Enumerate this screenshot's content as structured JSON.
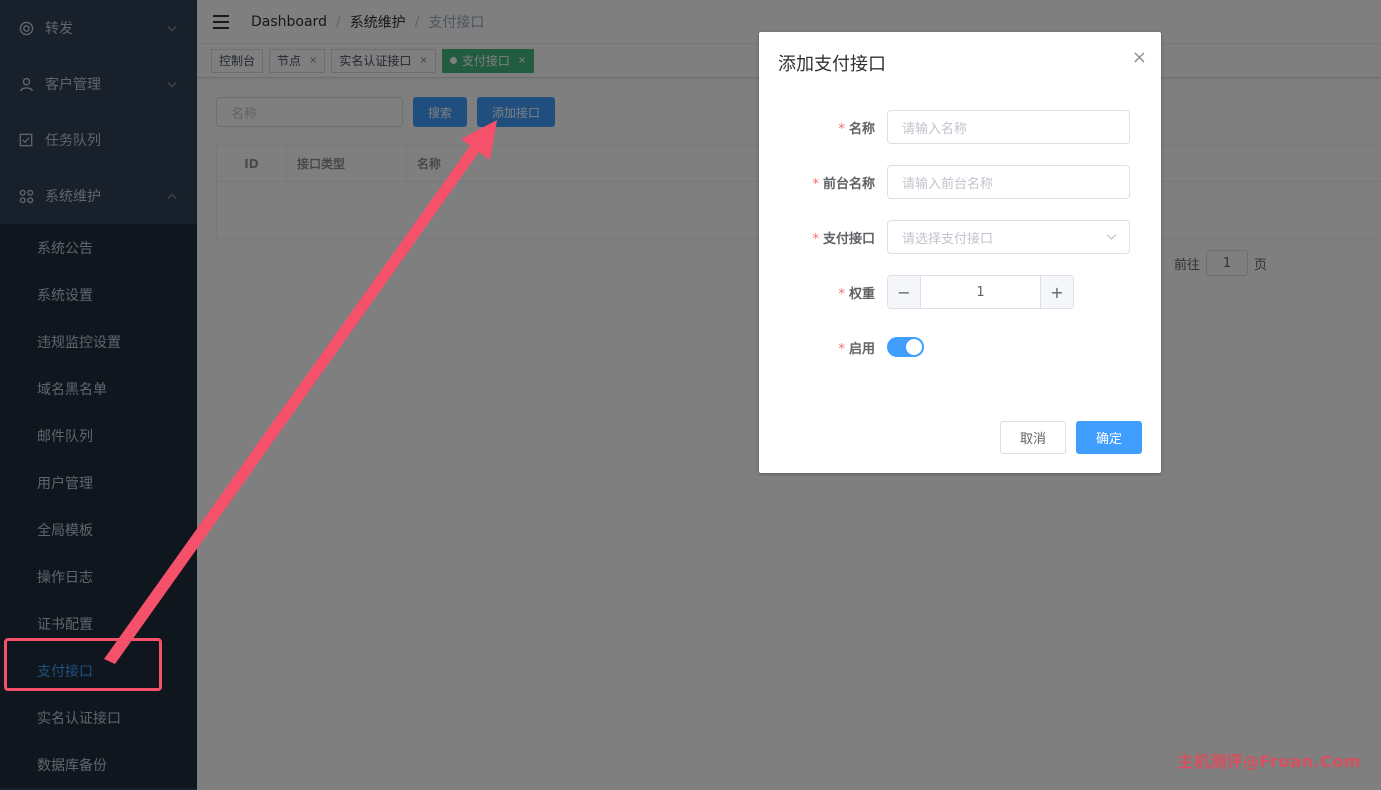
{
  "sidebar": {
    "top_items": [
      {
        "label": "转发",
        "icon": "target-icon"
      },
      {
        "label": "客户管理",
        "icon": "user-icon"
      },
      {
        "label": "任务队列",
        "icon": "checkbox-icon"
      },
      {
        "label": "系统维护",
        "icon": "command-icon"
      }
    ],
    "sub_items": [
      {
        "label": "系统公告"
      },
      {
        "label": "系统设置"
      },
      {
        "label": "违规监控设置"
      },
      {
        "label": "域名黑名单"
      },
      {
        "label": "邮件队列"
      },
      {
        "label": "用户管理"
      },
      {
        "label": "全局模板"
      },
      {
        "label": "操作日志"
      },
      {
        "label": "证书配置"
      },
      {
        "label": "支付接口"
      },
      {
        "label": "实名认证接口"
      },
      {
        "label": "数据库备份"
      }
    ],
    "active_item": "支付接口"
  },
  "breadcrumb": {
    "items": [
      "Dashboard",
      "系统维护",
      "支付接口"
    ],
    "separator": "/"
  },
  "tags": [
    {
      "label": "控制台"
    },
    {
      "label": "节点",
      "close": "×"
    },
    {
      "label": "实名认证接口",
      "close": "×"
    },
    {
      "label": "支付接口",
      "close": "×",
      "active": true
    }
  ],
  "filter": {
    "name_placeholder": "名称",
    "search_label": "搜索",
    "add_label": "添加接口"
  },
  "table": {
    "columns": [
      "ID",
      "接口类型",
      "名称"
    ]
  },
  "pager": {
    "goto_label": "前往",
    "page": "1",
    "page_suffix": "页"
  },
  "dialog": {
    "title": "添加支付接口",
    "close": "×",
    "required_mark": "*",
    "fields": {
      "name": {
        "label": "名称",
        "placeholder": "请输入名称"
      },
      "front_name": {
        "label": "前台名称",
        "placeholder": "请输入前台名称"
      },
      "gateway": {
        "label": "支付接口",
        "placeholder": "请选择支付接口"
      },
      "weight": {
        "label": "权重",
        "value": "1",
        "minus": "−",
        "plus": "+"
      },
      "enabled": {
        "label": "启用",
        "value": true
      }
    },
    "cancel_label": "取消",
    "confirm_label": "确定"
  },
  "watermark": "主机测评@Fruan.Com",
  "colors": {
    "sidebar_bg": "#304156",
    "submenu_bg": "#1f2d3d",
    "primary": "#409eff",
    "active_tag": "#42b983",
    "annotation": "#f5516a"
  }
}
